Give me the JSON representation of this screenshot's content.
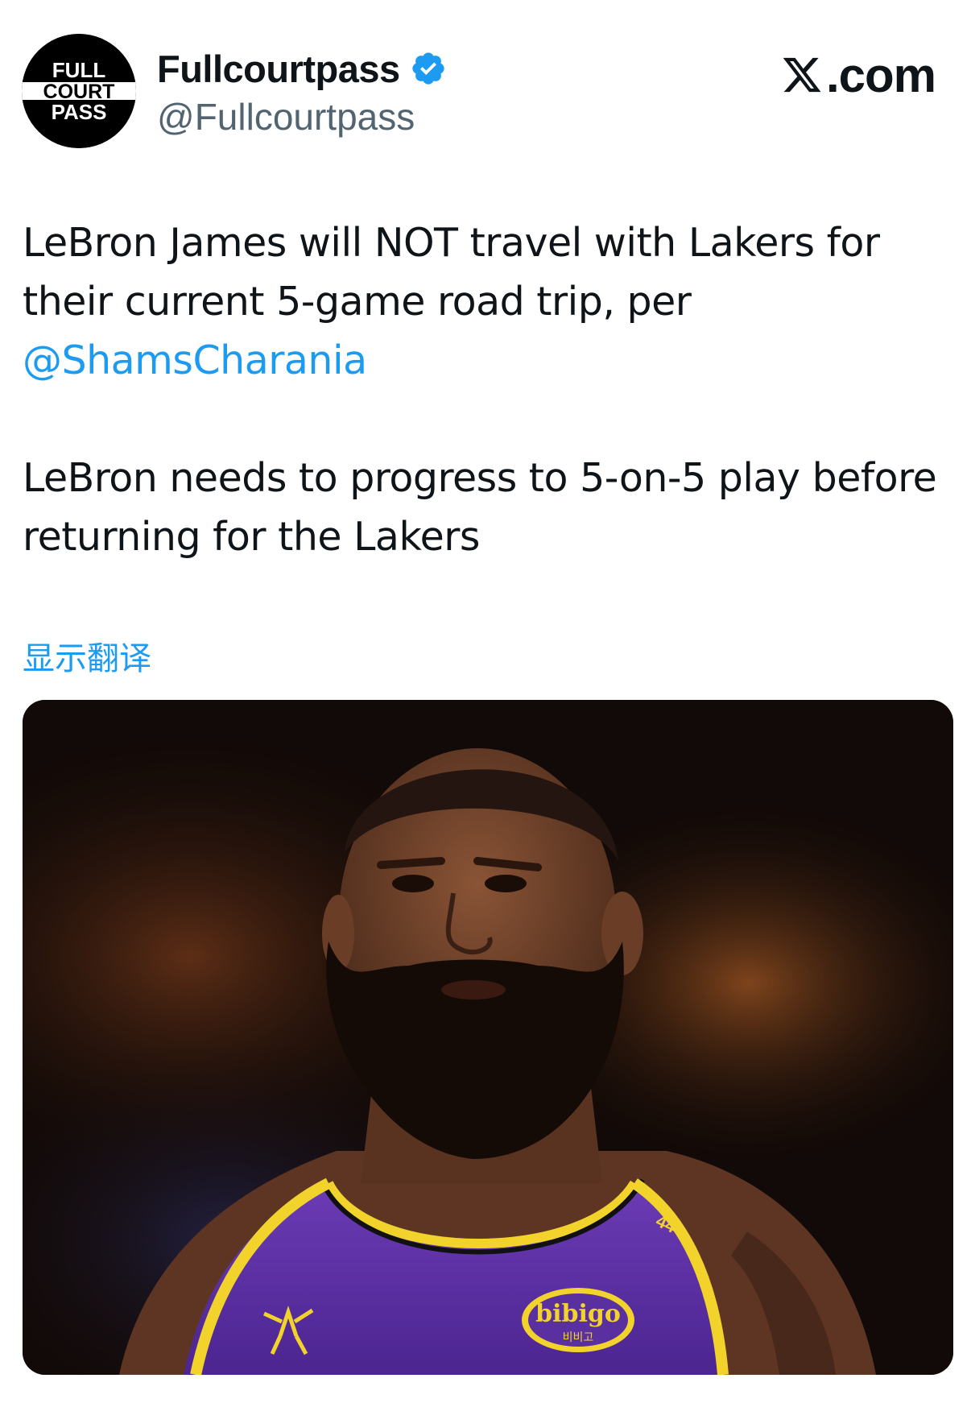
{
  "author": {
    "display_name": "Fullcourtpass",
    "handle": "@Fullcourtpass",
    "verified": true,
    "avatar_icon": "full-court-pass-logo",
    "avatar_text": [
      "FULL",
      "COURT",
      "PASS"
    ]
  },
  "brand": {
    "icon": "x-logo-icon",
    "domain_suffix": ".com"
  },
  "tweet": {
    "line1": "LeBron James will NOT travel with Lakers for their current 5-game road trip, per ",
    "mention": "@ShamsCharania",
    "line2": "LeBron needs to progress to 5-on-5 play before returning for the Lakers",
    "translate_label": "显示翻译"
  },
  "media": {
    "jersey_number": "44",
    "sponsor": "bibigo",
    "sponsor_sub": "비비고",
    "colors": {
      "jersey": "#5a2fa0",
      "trim": "#f2d32c",
      "background": "#120a08"
    }
  },
  "colors": {
    "link": "#1d9bf0",
    "verified": "#1d9bf0",
    "secondary_text": "#536471"
  }
}
